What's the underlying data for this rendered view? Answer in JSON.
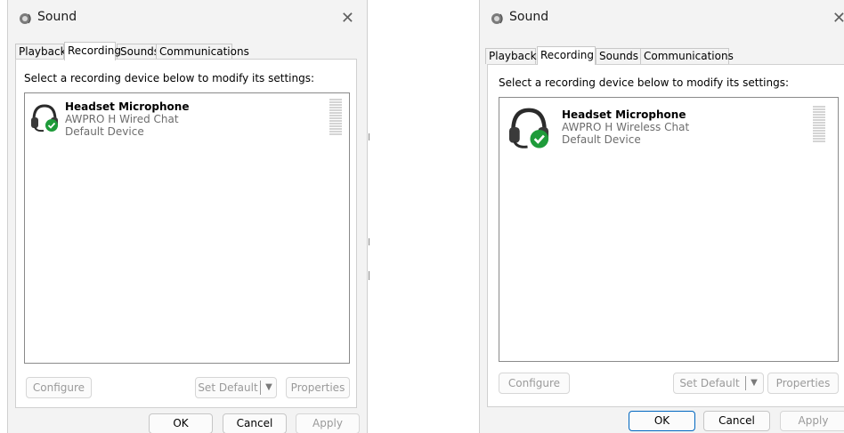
{
  "dialogs": [
    {
      "title": "Sound",
      "tabs": [
        "Playback",
        "Recording",
        "Sounds",
        "Communications"
      ],
      "active_tab": "Recording",
      "instruction": "Select a recording device below to modify its settings:",
      "device": {
        "name": "Headset Microphone",
        "description": "AWPRO H Wired Chat",
        "status": "Default Device",
        "icon": "headset-default-check-icon"
      },
      "buttons": {
        "configure": "Configure",
        "set_default": "Set Default",
        "properties": "Properties"
      },
      "footer": {
        "ok": "OK",
        "cancel": "Cancel",
        "apply": "Apply"
      }
    },
    {
      "title": "Sound",
      "tabs": [
        "Playback",
        "Recording",
        "Sounds",
        "Communications"
      ],
      "active_tab": "Recording",
      "instruction": "Select a recording device below to modify its settings:",
      "device": {
        "name": "Headset Microphone",
        "description": "AWPRO H Wireless Chat",
        "status": "Default Device",
        "icon": "headset-default-check-icon"
      },
      "buttons": {
        "configure": "Configure",
        "set_default": "Set Default",
        "properties": "Properties"
      },
      "footer": {
        "ok": "OK",
        "cancel": "Cancel",
        "apply": "Apply"
      }
    }
  ],
  "colors": {
    "default_check": "#1e9b3a",
    "accent": "#0067c0",
    "window_bg": "#f3f3f3"
  }
}
